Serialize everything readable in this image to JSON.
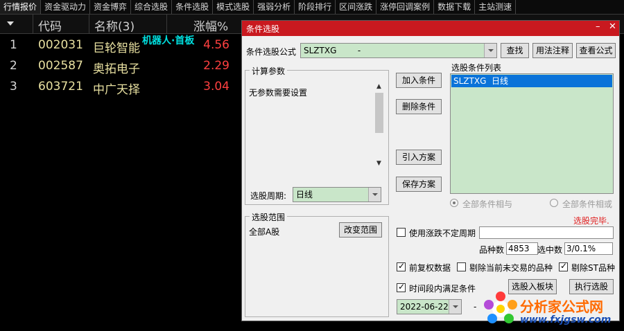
{
  "menu": {
    "tabs": [
      "行情报价",
      "资金驱动力",
      "资金博弈",
      "综合选股",
      "条件选股",
      "模式选股",
      "强弱分析",
      "阶段排行",
      "区间涨跌",
      "涨停回调案例",
      "数据下载",
      "主站测速"
    ]
  },
  "list": {
    "headers": {
      "code": "代码",
      "name": "名称(3)",
      "change": "涨幅%"
    },
    "rows": [
      {
        "idx": "1",
        "code": "002031",
        "name": "巨轮智能",
        "change": "4.56"
      },
      {
        "idx": "2",
        "code": "002587",
        "name": "奥拓电子",
        "change": "2.29"
      },
      {
        "idx": "3",
        "code": "603721",
        "name": "中广天择",
        "change": "3.04"
      }
    ],
    "overlay_label": "机器人·首板"
  },
  "dialog": {
    "title": "条件选股",
    "close_icon": "close-icon",
    "formula_label": "条件选股公式",
    "formula_value": "SLZTXG        -",
    "find_button": "查找",
    "usage_button": "用法注释",
    "view_formula_button": "查看公式",
    "params_group": "计算参数",
    "no_params_text": "无参数需要设置",
    "period_label": "选股周期:",
    "period_value": "日线",
    "add_condition_button": "加入条件",
    "delete_condition_button": "删除条件",
    "import_plan_button": "引入方案",
    "save_plan_button": "保存方案",
    "condition_list_label": "选股条件列表",
    "condition_list_items": [
      "SLZTXG  日线"
    ],
    "radio_and_label": "全部条件相与",
    "radio_or_label": "全部条件相或",
    "status_text": "选股完毕.",
    "scope_group": "选股范围",
    "scope_value": "全部A股",
    "change_scope_button": "改变范围",
    "use_variable_period_label": "使用涨跌不定周期",
    "variety_count_label": "品种数",
    "variety_count_value": "4853",
    "selected_count_label": "选中数",
    "selected_count_value": "3/0.1%",
    "prefix_adjust_label": "前复权数据",
    "exclude_untraded_label": "剔除当前未交易的品种",
    "exclude_st_label": "剔除ST品种",
    "time_range_label": "时间段内满足条件",
    "select_to_block_button": "选股入板块",
    "execute_button": "执行选股",
    "date_value": "2022-06-22",
    "date_separator": "-"
  },
  "watermark": {
    "text": "分析家公式网",
    "url": "www.fxjgsw.com"
  },
  "colors": {
    "title_bar": "#c9191f",
    "change_up": "#ff4040",
    "code_text": "#e8e0a0",
    "status_red": "#e02020",
    "selection_blue": "#0a73d9",
    "list_green": "#c9e6c9"
  }
}
